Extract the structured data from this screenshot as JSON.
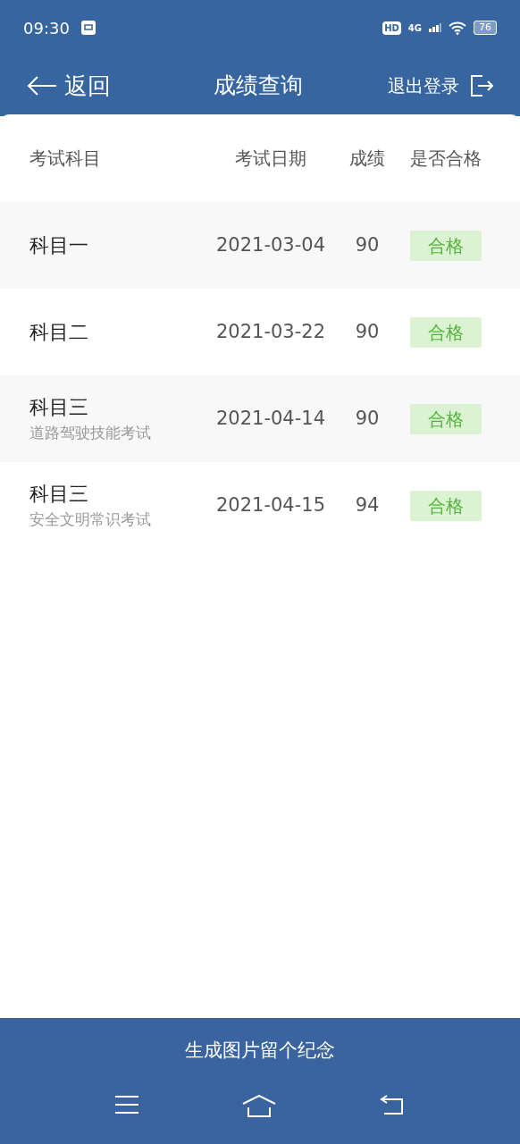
{
  "status_bar": {
    "time": "09:30",
    "hd": "HD",
    "network": "4G",
    "battery": "76"
  },
  "header": {
    "back": "返回",
    "title": "成绩查询",
    "logout": "退出登录"
  },
  "table": {
    "columns": [
      "考试科目",
      "考试日期",
      "成绩",
      "是否合格"
    ],
    "rows": [
      {
        "subject": "科目一",
        "date": "2021-03-04",
        "score": "90",
        "result": "合格",
        "passed": true
      },
      {
        "subject": "科目二",
        "date": "2021-03-22",
        "score": "90",
        "result": "合格",
        "passed": true
      },
      {
        "subject": "科目三",
        "subtitle": "道路驾驶技能考试",
        "date": "2021-04-14",
        "score": "90",
        "result": "合格",
        "passed": true
      },
      {
        "subject": "科目三",
        "subtitle": "安全文明常识考试",
        "date": "2021-04-15",
        "score": "94",
        "result": "合格",
        "passed": true
      }
    ]
  },
  "footer": {
    "button": "生成图片留个纪念"
  }
}
